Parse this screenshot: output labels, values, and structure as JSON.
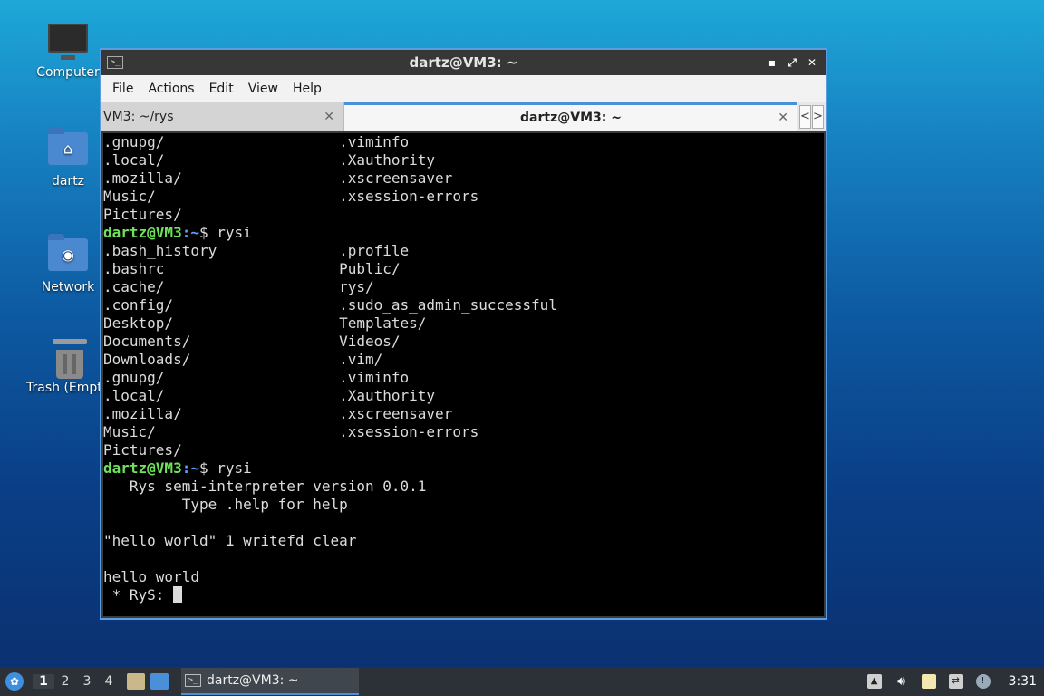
{
  "desktop": {
    "icons": [
      {
        "label": "Computer"
      },
      {
        "label": "dartz"
      },
      {
        "label": "Network"
      },
      {
        "label": "Trash (Empt"
      }
    ]
  },
  "window": {
    "title": "dartz@VM3: ~",
    "menu": [
      "File",
      "Actions",
      "Edit",
      "View",
      "Help"
    ],
    "tabs": [
      {
        "label": "VM3: ~/rys",
        "active": false
      },
      {
        "label": "dartz@VM3: ~",
        "active": true
      }
    ],
    "tab_scroll_left": "<",
    "tab_scroll_right": ">"
  },
  "terminal": {
    "prompt_user": "dartz@VM3",
    "prompt_path": ":~",
    "lines": [
      {
        "type": "text",
        "text": ".gnupg/                    .viminfo"
      },
      {
        "type": "text",
        "text": ".local/                    .Xauthority"
      },
      {
        "type": "text",
        "text": ".mozilla/                  .xscreensaver"
      },
      {
        "type": "text",
        "text": "Music/                     .xsession-errors"
      },
      {
        "type": "text",
        "text": "Pictures/"
      },
      {
        "type": "prompt",
        "cmd": "$ rysi"
      },
      {
        "type": "text",
        "text": ".bash_history              .profile"
      },
      {
        "type": "text",
        "text": ".bashrc                    Public/"
      },
      {
        "type": "text",
        "text": ".cache/                    rys/"
      },
      {
        "type": "text",
        "text": ".config/                   .sudo_as_admin_successful"
      },
      {
        "type": "text",
        "text": "Desktop/                   Templates/"
      },
      {
        "type": "text",
        "text": "Documents/                 Videos/"
      },
      {
        "type": "text",
        "text": "Downloads/                 .vim/"
      },
      {
        "type": "text",
        "text": ".gnupg/                    .viminfo"
      },
      {
        "type": "text",
        "text": ".local/                    .Xauthority"
      },
      {
        "type": "text",
        "text": ".mozilla/                  .xscreensaver"
      },
      {
        "type": "text",
        "text": "Music/                     .xsession-errors"
      },
      {
        "type": "text",
        "text": "Pictures/"
      },
      {
        "type": "prompt",
        "cmd": "$ rysi"
      },
      {
        "type": "text",
        "text": "   Rys semi-interpreter version 0.0.1"
      },
      {
        "type": "text",
        "text": "         Type .help for help"
      },
      {
        "type": "text",
        "text": ""
      },
      {
        "type": "text",
        "text": "\"hello world\" 1 writefd clear"
      },
      {
        "type": "text",
        "text": ""
      },
      {
        "type": "text",
        "text": "hello world"
      },
      {
        "type": "input",
        "text": " * RyS: "
      }
    ]
  },
  "taskbar": {
    "workspaces": [
      "1",
      "2",
      "3",
      "4"
    ],
    "current_workspace": "1",
    "task_label": "dartz@VM3: ~",
    "clock": "3:31"
  }
}
